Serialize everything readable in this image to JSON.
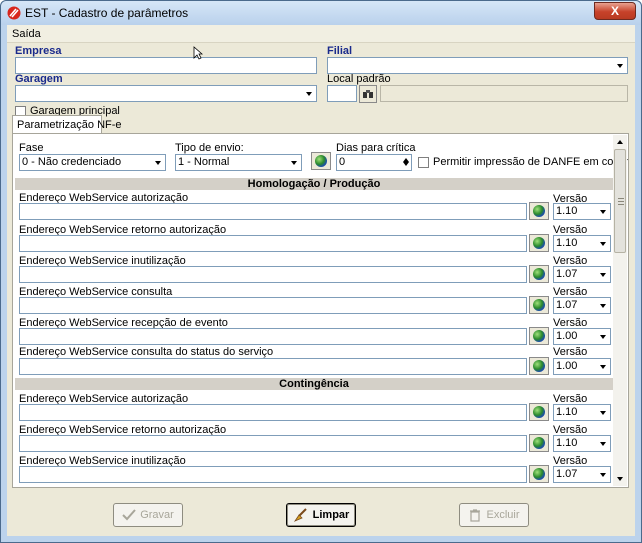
{
  "window": {
    "title": "EST - Cadastro de parâmetros",
    "close_label": "X"
  },
  "menu": {
    "items": [
      "Saída"
    ]
  },
  "form": {
    "empresa_label": "Empresa",
    "filial_label": "Filial",
    "garagem_label": "Garagem",
    "local_padrao_label": "Local padrão",
    "garagem_principal_label": "Garagem principal"
  },
  "tab": {
    "label": "Parametrização NF-e"
  },
  "nfe": {
    "fase_label": "Fase",
    "fase_value": "0 - Não credenciado",
    "tipo_envio_label": "Tipo de envio:",
    "tipo_envio_value": "1 - Normal",
    "dias_critica_label": "Dias para crítica",
    "dias_critica_value": "0",
    "permitir_label": "Permitir impressão de DANFE em contingência"
  },
  "sections": [
    {
      "title": "Homologação / Produção",
      "rows": [
        {
          "label": "Endereço WebService autorização",
          "versao_label": "Versão",
          "versao": "1.10"
        },
        {
          "label": "Endereço WebService retorno autorização",
          "versao_label": "Versão",
          "versao": "1.10"
        },
        {
          "label": "Endereço WebService inutilização",
          "versao_label": "Versão",
          "versao": "1.07"
        },
        {
          "label": "Endereço WebService consulta",
          "versao_label": "Versão",
          "versao": "1.07"
        },
        {
          "label": "Endereço WebService recepção de evento",
          "versao_label": "Versão",
          "versao": "1.00"
        },
        {
          "label": "Endereço WebService consulta do status do serviço",
          "versao_label": "Versão",
          "versao": "1.00"
        }
      ]
    },
    {
      "title": "Contingência",
      "rows": [
        {
          "label": "Endereço WebService autorização",
          "versao_label": "Versão",
          "versao": "1.10"
        },
        {
          "label": "Endereço WebService retorno autorização",
          "versao_label": "Versão",
          "versao": "1.10"
        },
        {
          "label": "Endereço WebService inutilização",
          "versao_label": "Versão",
          "versao": "1.07"
        }
      ]
    }
  ],
  "buttons": {
    "gravar": "Gravar",
    "limpar": "Limpar",
    "excluir": "Excluir"
  },
  "icons": {
    "app": "est-logo-icon",
    "web": "globe-icon",
    "search": "binoculars-icon",
    "gravar": "check-icon",
    "limpar": "broom-icon",
    "excluir": "trash-icon"
  }
}
